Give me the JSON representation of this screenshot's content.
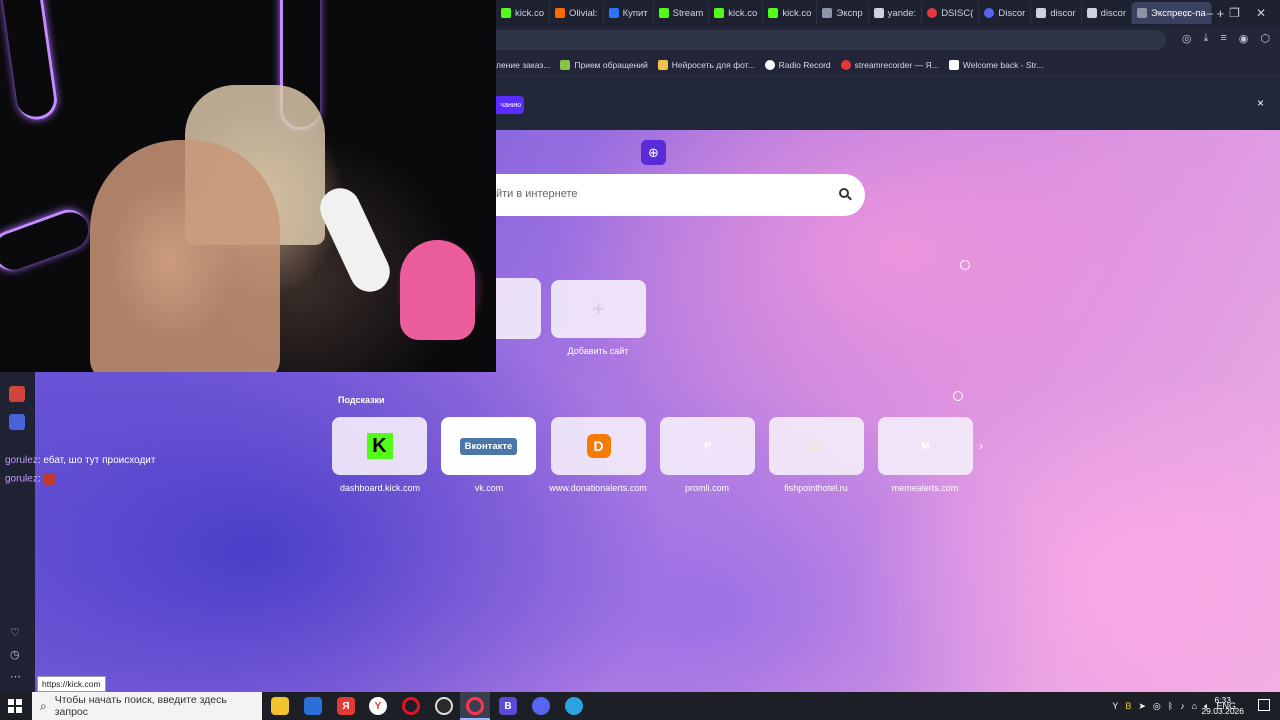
{
  "tabs": [
    {
      "label": "kick.co",
      "color": "#53fc18"
    },
    {
      "label": "Olivial:",
      "color": "#ff6a00"
    },
    {
      "label": "Купит",
      "color": "#2a73ff"
    },
    {
      "label": "Stream",
      "color": "#53fc18"
    },
    {
      "label": "kick.co",
      "color": "#53fc18"
    },
    {
      "label": "kick.co",
      "color": "#53fc18"
    },
    {
      "label": "Экспр",
      "color": "#8d93a8"
    },
    {
      "label": "yande:",
      "color": "#cfd2de"
    },
    {
      "label": "DSISC(",
      "color": "#e63b3b"
    },
    {
      "label": "Discor",
      "color": "#5865f2"
    },
    {
      "label": "discor",
      "color": "#cfd2de"
    },
    {
      "label": "discor",
      "color": "#cfd2de"
    },
    {
      "label": "Экспресс-па",
      "color": "#8d93a8",
      "active": true
    }
  ],
  "bookmarks": [
    {
      "label": "ление заказ...",
      "color": ""
    },
    {
      "label": "Прием обращений",
      "color": "#8bc34a"
    },
    {
      "label": "Нейросеть для фот...",
      "color": "#f2c14e"
    },
    {
      "label": "Radio Record",
      "color": "#ffffff"
    },
    {
      "label": "streamrecorder — Я...",
      "color": "#e53935"
    },
    {
      "label": "Welcome back - Str...",
      "color": "#ffffff"
    }
  ],
  "notice": {
    "button_label": "чанию",
    "close": "×"
  },
  "search": {
    "placeholder": "йти в интернете"
  },
  "add_site_label": "Добавить сайт",
  "hints_label": "Подсказки",
  "suggestions": [
    {
      "label": "dashboard.kick.com",
      "glyph": "K"
    },
    {
      "label": "vk.com",
      "glyph": "Вконтакте"
    },
    {
      "label": "www.donationalerts.com",
      "glyph": "D"
    },
    {
      "label": "promli.com",
      "glyph": "P"
    },
    {
      "label": "fishpointhotel.ru",
      "glyph": "◌"
    },
    {
      "label": "memealerts.com",
      "glyph": "M"
    }
  ],
  "chat": [
    {
      "user": "gorulez",
      "text": ": ебат, шо тут происходит"
    },
    {
      "user": "gorulez",
      "text": ": "
    }
  ],
  "status_url": "https://kick.com",
  "taskbar": {
    "search_placeholder": "Чтобы начать поиск, введите здесь запрос",
    "lang": "ENG",
    "time": "6:33",
    "date": "29.03.2026"
  }
}
